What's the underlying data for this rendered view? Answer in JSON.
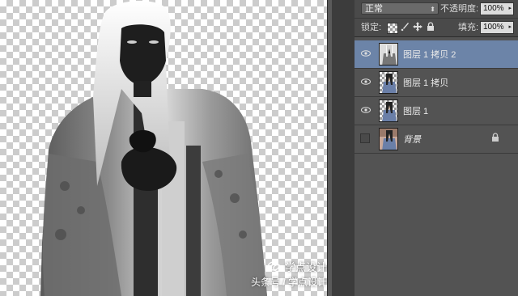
{
  "layers_panel": {
    "blend_mode": "正常",
    "opacity_label": "不透明度:",
    "opacity_value": "100%",
    "lock_label": "锁定:",
    "fill_label": "填充:",
    "fill_value": "100%",
    "layers": [
      {
        "name": "图层 1 拷贝 2",
        "visible": true,
        "selected": true
      },
      {
        "name": "图层 1 拷贝",
        "visible": true,
        "selected": false
      },
      {
        "name": "图层 1",
        "visible": true,
        "selected": false
      },
      {
        "name": "背景",
        "visible": false,
        "selected": false,
        "locked": true
      }
    ]
  },
  "watermark": {
    "brand": "学点设计",
    "source": "头条号 / 学点设计"
  },
  "colors": {
    "selected_layer": "#6c84a8",
    "panel_bg": "#535353"
  },
  "icons": [
    "eye-icon",
    "lock-icon",
    "brush-icon",
    "move-icon",
    "checker-lock-icon",
    "wechat-icon"
  ]
}
